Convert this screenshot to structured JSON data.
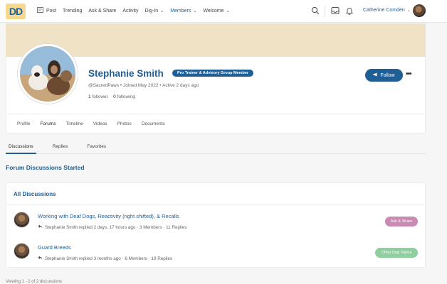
{
  "colors": {
    "brand": "#1f5f96",
    "cover": "#f0e2c4",
    "tag_ask": "#c98ab4",
    "tag_other": "#8fcf9e"
  },
  "logo": {
    "text": "DD"
  },
  "nav": {
    "items": [
      {
        "label": "Post",
        "icon": "post-icon"
      },
      {
        "label": "Trending"
      },
      {
        "label": "Ask & Share"
      },
      {
        "label": "Activity"
      },
      {
        "label": "Dig-In",
        "dropdown": true
      },
      {
        "label": "Members",
        "dropdown": true,
        "active": true
      },
      {
        "label": "Welcome",
        "dropdown": true
      }
    ],
    "icons": [
      "search-icon",
      "inbox-icon",
      "bell-icon"
    ],
    "user": {
      "name": "Catherine Comden"
    }
  },
  "profile": {
    "name": "Stephanie Smith",
    "badge": "Pro Trainer & Advisory Group Member",
    "meta": "@SacredPaws • Joined May 2022 • Active 2 days ago",
    "followers_count": "1",
    "followers_label": "follower",
    "following_count": "0",
    "following_label": "following",
    "follow_label": "Follow",
    "more_label": "•••",
    "tabs": [
      "Profile",
      "Forums",
      "Timeline",
      "Videos",
      "Photos",
      "Documents"
    ],
    "active_tab": "Forums"
  },
  "subtabs": [
    "Discussions",
    "Replies",
    "Favorites"
  ],
  "section_title": "Forum Discussions Started",
  "list": {
    "heading": "All Discussions",
    "rows": [
      {
        "title": "Working with Deaf Dogs, Reactivity (right shifted), & Recalls",
        "meta": "Stephanie Smith replied 2 days, 17 hours ago · 3 Members · 11 Replies",
        "tag": "Ask & Share"
      },
      {
        "title": "Guard Breeds",
        "meta": "Stephanie Smith replied 3 months ago · 6 Members · 19 Replies",
        "tag": "Other Dog Topics"
      }
    ]
  },
  "footer": {
    "text": "Viewing 1 - 2 of 2 discussions"
  }
}
